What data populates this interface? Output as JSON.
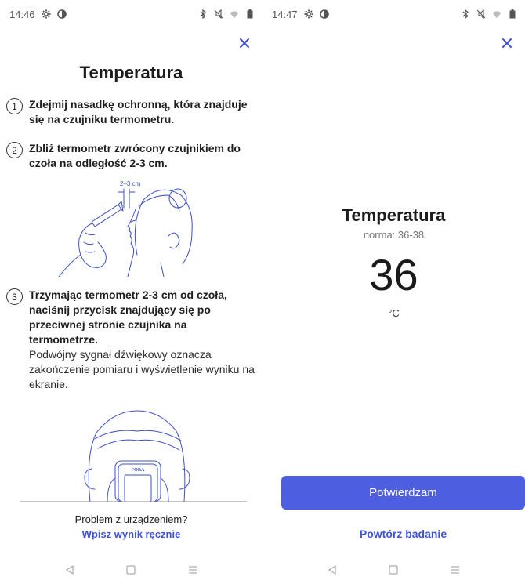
{
  "left_screen": {
    "status": {
      "time": "14:46"
    },
    "title": "Temperatura",
    "steps": [
      {
        "num": "1",
        "text": "Zdejmij nasadkę ochronną, która znajduje się na czujniku termometru."
      },
      {
        "num": "2",
        "text": "Zbliż termometr zwrócony czujnikiem do czoła na odległość 2-3 cm."
      },
      {
        "num": "3",
        "text": "Trzymając termometr 2-3 cm od czoła, naciśnij przycisk znajdujący się po przeciwnej stronie czujnika na termometrze.",
        "sub": "Podwójny sygnał dźwiękowy oznacza zakończenie pomiaru i wyświetlenie wyniku na ekranie."
      }
    ],
    "illustration_label": "2–3 cm",
    "device_brand": "FORA",
    "footer_question": "Problem z urządzeniem?",
    "footer_link": "Wpisz wynik ręcznie"
  },
  "right_screen": {
    "status": {
      "time": "14:47"
    },
    "title": "Temperatura",
    "norm": "norma: 36-38",
    "value": "36",
    "unit": "°C",
    "confirm_label": "Potwierdzam",
    "repeat_label": "Powtórz badanie"
  },
  "theme": {
    "accent": "#4d5fe0",
    "link": "#3f51d6",
    "illustration": "#3d4fc4"
  },
  "icons": [
    "settings-icon",
    "vpn-key-icon",
    "bluetooth-icon",
    "mute-icon",
    "wifi-icon",
    "battery-icon",
    "close-icon",
    "back-icon",
    "home-icon",
    "menu-icon"
  ]
}
